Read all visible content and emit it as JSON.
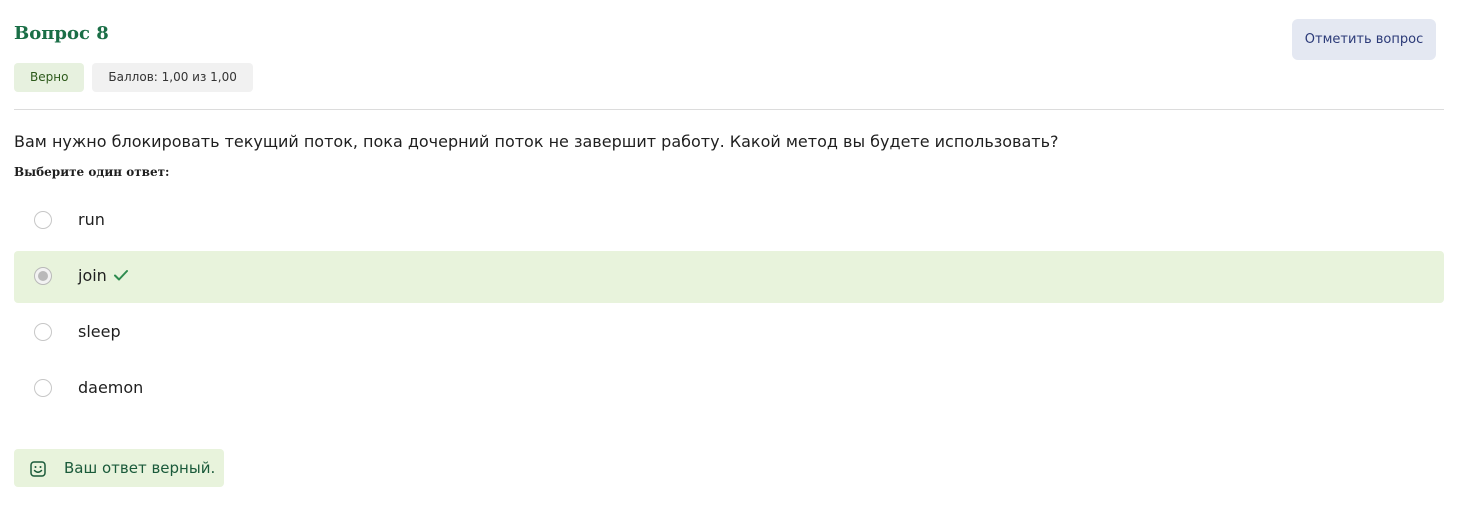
{
  "question": {
    "title": "Вопрос 8",
    "flag_button_label": "Отметить вопрос",
    "status_badge": "Верно",
    "score_badge": "Баллов: 1,00 из 1,00",
    "text": "Вам нужно блокировать текущий поток, пока дочерний поток не завершит работу. Какой метод вы будете использовать?",
    "answer_prompt": "Выберите один ответ:"
  },
  "options": [
    {
      "label": "run",
      "selected": false,
      "correct": false
    },
    {
      "label": "join",
      "selected": true,
      "correct": true
    },
    {
      "label": "sleep",
      "selected": false,
      "correct": false
    },
    {
      "label": "daemon",
      "selected": false,
      "correct": false
    }
  ],
  "feedback": {
    "icon": "smile-icon",
    "text": "Ваш ответ верный."
  },
  "colors": {
    "title": "#1a6e46",
    "selected_bg": "#e8f3dc",
    "check": "#2e8b4f",
    "flag_button_bg": "#e4e8f2"
  }
}
